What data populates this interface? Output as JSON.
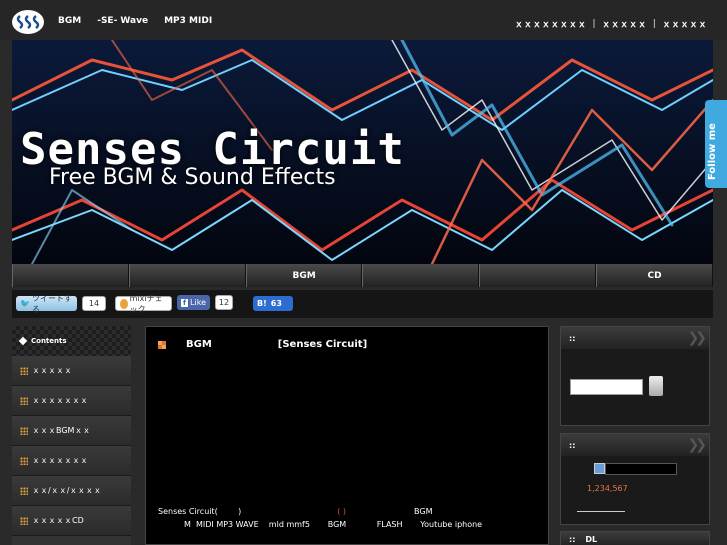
{
  "header": {
    "nav": [
      "BGM",
      "-SE- Wave",
      "MP3 MIDI"
    ],
    "links": [
      "ｘｘｘｘｘｘｘｘ",
      "ｘｘｘｘｘ",
      "ｘｘｘｘｘ"
    ]
  },
  "banner": {
    "title": "Senses Circuit",
    "subtitle": "Free BGM & Sound Effects"
  },
  "follow": {
    "label": "Follow me"
  },
  "tabs": [
    "",
    "",
    "BGM",
    "",
    "",
    "CD"
  ],
  "social": {
    "tweet_label": "ツイートする",
    "tweet_count": "14",
    "mixi_label": "mixiチェック",
    "fb_label": "Like",
    "fb_count": "12",
    "hatena_label": "B!",
    "hatena_count": "63"
  },
  "left_sidebar": {
    "heading": "Contents",
    "items": [
      "ｘｘｘｘｘ",
      "ｘｘｘｘｘｘｘ",
      "ｘｘｘBGMｘｘ",
      "ｘｘｘｘｘｘｘ",
      "ｘｘ/ｘｘ/ｘｘｘｘ",
      "ｘｘｘｘｘCD"
    ]
  },
  "main": {
    "title": "BGM",
    "title2": "[Senses Circuit]",
    "line1_a": "Senses Circuit(        )",
    "line1_red": "( )",
    "line1_b": "BGM",
    "line2": "M  MIDI MP3 WAVE    mld mmf5       BGM            FLASH       Youtube iphone"
  },
  "right_sidebar": {
    "search_heading": "::",
    "counter_heading": "::",
    "counter_value": "1,234,567",
    "dl_heading": "DL"
  },
  "colors": {
    "accent": "#e0782a",
    "counter": "#e4744a"
  }
}
